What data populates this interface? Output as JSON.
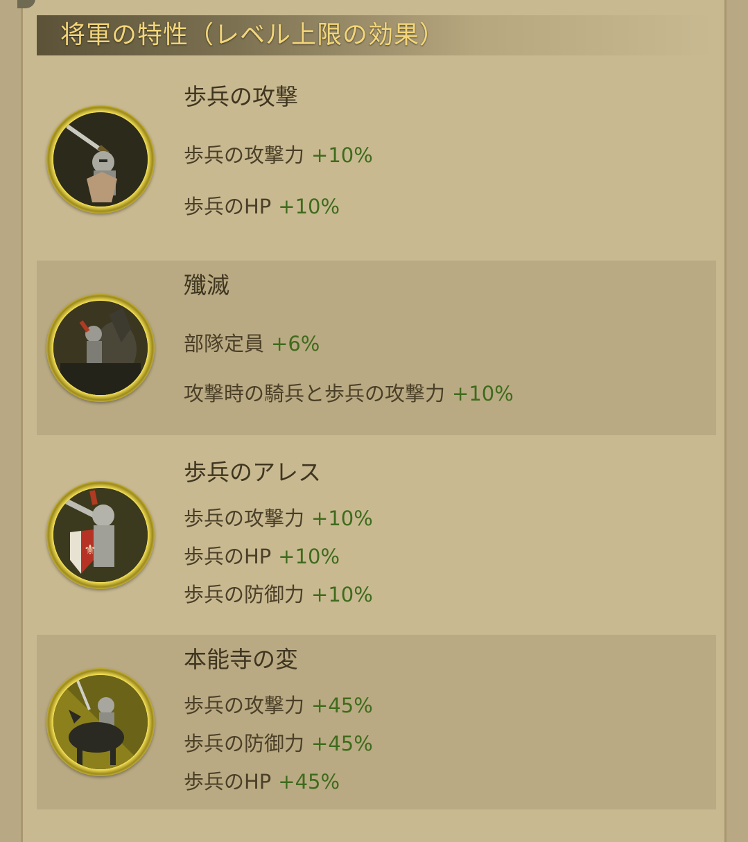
{
  "header": {
    "title": "将軍の特性（レベル上限の効果）"
  },
  "traits": [
    {
      "name": "歩兵の攻撃",
      "icon": "infantry-knight-sword-icon",
      "effects": [
        {
          "label": "歩兵の攻撃力",
          "value": "+10%"
        },
        {
          "label": "歩兵のHP",
          "value": "+10%"
        }
      ]
    },
    {
      "name": "殲滅",
      "icon": "cavalry-charge-icon",
      "effects": [
        {
          "label": "部隊定員",
          "value": "+6%"
        },
        {
          "label": "攻撃時の騎兵と歩兵の攻撃力",
          "value": "+10%"
        }
      ]
    },
    {
      "name": "歩兵のアレス",
      "icon": "knight-shield-icon",
      "effects": [
        {
          "label": "歩兵の攻撃力",
          "value": "+10%"
        },
        {
          "label": "歩兵のHP",
          "value": "+10%"
        },
        {
          "label": "歩兵の防御力",
          "value": "+10%"
        }
      ]
    },
    {
      "name": "本能寺の変",
      "icon": "mounted-knight-icon",
      "effects": [
        {
          "label": "歩兵の攻撃力",
          "value": "+45%"
        },
        {
          "label": "歩兵の防御力",
          "value": "+45%"
        },
        {
          "label": "歩兵のHP",
          "value": "+45%"
        }
      ]
    }
  ],
  "colors": {
    "value_green": "#3f6b1c",
    "title_gold": "#f3d67a",
    "frame_gold": "#e2cc45"
  }
}
